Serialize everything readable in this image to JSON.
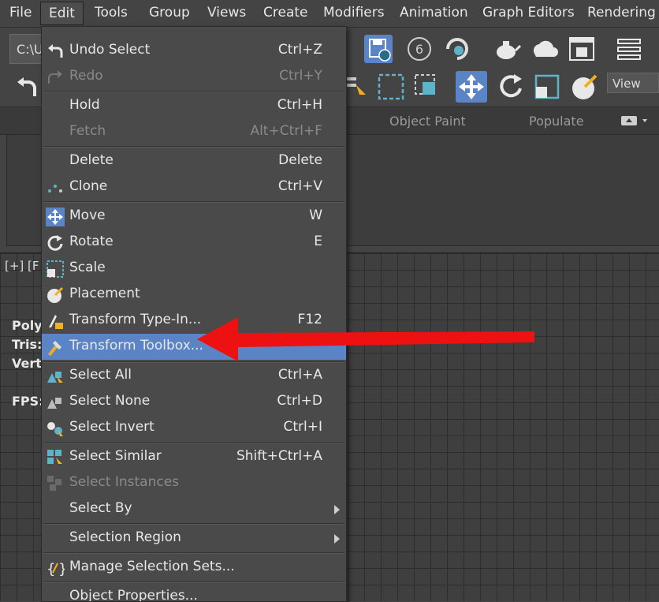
{
  "menubar": {
    "items": [
      "File",
      "Edit",
      "Tools",
      "Group",
      "Views",
      "Create",
      "Modifiers",
      "Animation",
      "Graph Editors",
      "Rendering"
    ]
  },
  "toolbar": {
    "path_text": "C:\\U",
    "view_dropdown": "View",
    "ribbon_tabs": [
      "Object Paint",
      "Populate"
    ]
  },
  "viewport": {
    "label": "[+] [F",
    "stats": [
      "Poly",
      "Tris:",
      "Vert",
      "FPS:"
    ]
  },
  "edit_menu": {
    "items": [
      {
        "label": "Undo Select",
        "shortcut": "Ctrl+Z",
        "icon": "undo-icon"
      },
      {
        "label": "Redo",
        "shortcut": "Ctrl+Y",
        "icon": "redo-icon"
      },
      {
        "label": "Hold",
        "shortcut": "Ctrl+H"
      },
      {
        "label": "Fetch",
        "shortcut": "Alt+Ctrl+F"
      },
      {
        "label": "Delete",
        "shortcut": "Delete"
      },
      {
        "label": "Clone",
        "shortcut": "Ctrl+V",
        "icon": "clone-icon"
      },
      {
        "label": "Move",
        "shortcut": "W",
        "icon": "move-icon"
      },
      {
        "label": "Rotate",
        "shortcut": "E",
        "icon": "rotate-icon"
      },
      {
        "label": "Scale",
        "shortcut": "",
        "icon": "scale-icon"
      },
      {
        "label": "Placement",
        "shortcut": "",
        "icon": "placement-icon"
      },
      {
        "label": "Transform Type-In...",
        "shortcut": "F12",
        "icon": "transform-type-in-icon"
      },
      {
        "label": "Transform Toolbox...",
        "shortcut": "",
        "icon": "transform-toolbox-icon"
      },
      {
        "label": "Select All",
        "shortcut": "Ctrl+A",
        "icon": "select-all-icon"
      },
      {
        "label": "Select None",
        "shortcut": "Ctrl+D",
        "icon": "select-none-icon"
      },
      {
        "label": "Select Invert",
        "shortcut": "Ctrl+I",
        "icon": "select-invert-icon"
      },
      {
        "label": "Select Similar",
        "shortcut": "Shift+Ctrl+A",
        "icon": "select-similar-icon"
      },
      {
        "label": "Select Instances",
        "shortcut": "",
        "icon": "select-instances-icon"
      },
      {
        "label": "Select By",
        "shortcut": ""
      },
      {
        "label": "Selection Region",
        "shortcut": ""
      },
      {
        "label": "Manage Selection Sets...",
        "shortcut": "",
        "icon": "manage-selection-sets-icon"
      },
      {
        "label": "Object Properties...",
        "shortcut": ""
      }
    ]
  },
  "colors": {
    "highlight": "#5b84c7",
    "arrow": "#ee1111",
    "accent": "#5fb3c9"
  }
}
